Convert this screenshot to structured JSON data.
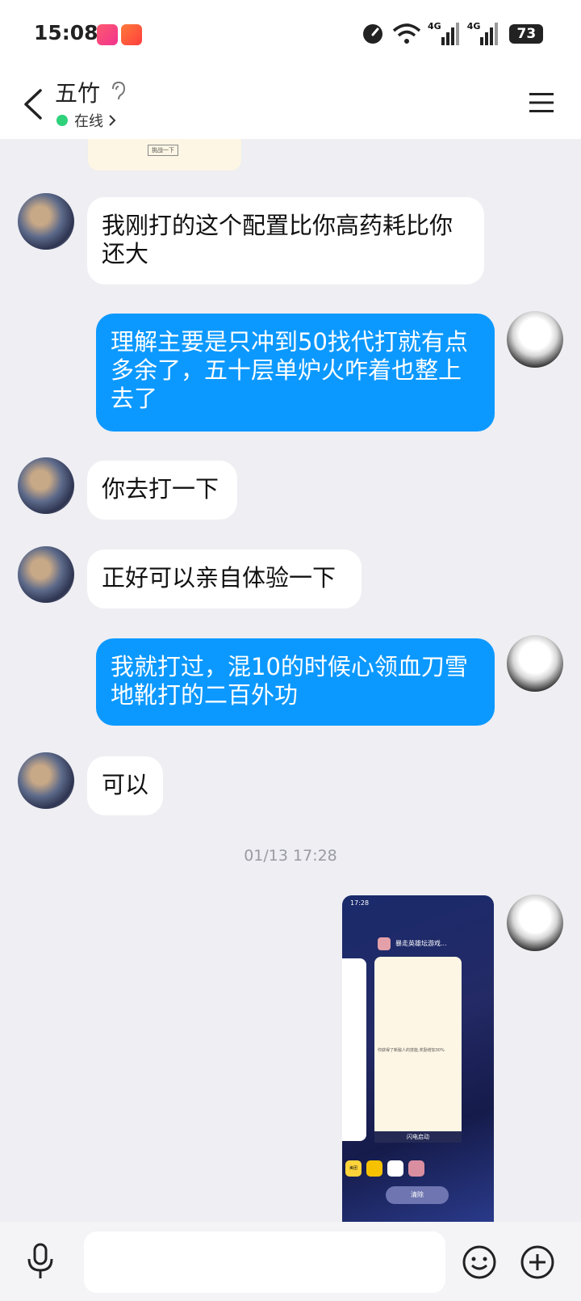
{
  "status_bar": {
    "time": "15:08",
    "battery": "73",
    "net1": "4G",
    "net2": "4G"
  },
  "header": {
    "title": "五竹",
    "presence": "在线"
  },
  "messages": [
    {
      "side": "in",
      "text": "我刚打的这个配置比你高药耗比你还大"
    },
    {
      "side": "out",
      "text": "理解主要是只冲到50找代打就有点多余了，五十层单炉火咋着也整上去了"
    },
    {
      "side": "in",
      "text": "你去打一下"
    },
    {
      "side": "in",
      "text": "正好可以亲自体验一下"
    },
    {
      "side": "out",
      "text": "我就打过，混10的时候心领血刀雪地靴打的二百外功"
    },
    {
      "side": "in",
      "text": "可以"
    }
  ],
  "top_snippet_label": "挑战一下",
  "timestamp": "01/13 17:28",
  "screenshot_msg": {
    "time": "17:28",
    "app_title": "暴走英雄坛游戏...",
    "card_text": "你获得了新敌人的技能,奖励增加30%",
    "launch_label": "闪电启动",
    "clear_label": "清除",
    "dock_label": "美团"
  },
  "colors": {
    "accent": "#0c99ff",
    "online": "#2fd17b"
  }
}
